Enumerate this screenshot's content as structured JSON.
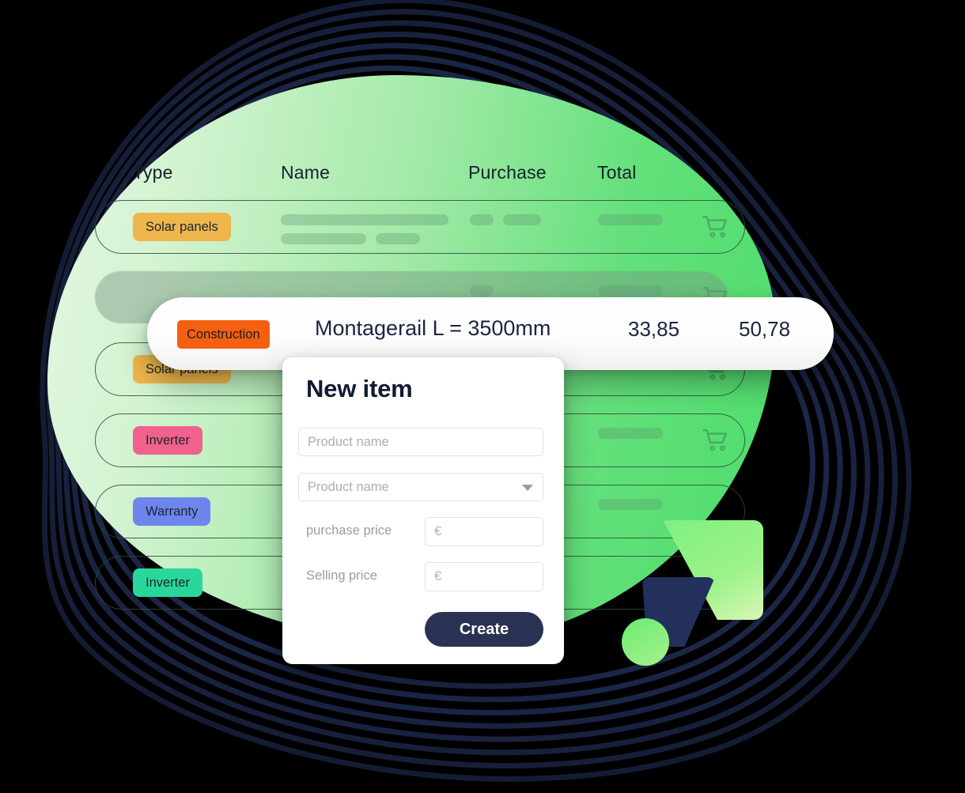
{
  "table": {
    "headers": [
      "Type",
      "Name",
      "Purchase",
      "Total"
    ],
    "rows": [
      {
        "badge": "Solar panels",
        "badge_color": "#eeb64b",
        "cart_icon": "shopping-cart-icon"
      },
      {
        "badge": "",
        "badge_color": "",
        "cart_icon": "shopping-cart-icon"
      },
      {
        "badge": "Solar panels",
        "badge_color": "#eeb64b",
        "cart_icon": "shopping-cart-icon"
      },
      {
        "badge": "Inverter",
        "badge_color": "#f0628c",
        "cart_icon": "shopping-cart-icon"
      },
      {
        "badge": "Warranty",
        "badge_color": "#6f85ee",
        "cart_icon": "shopping-cart-icon"
      },
      {
        "badge": "Inverter",
        "badge_color": "#2ad79b",
        "cart_icon": "shopping-cart-icon"
      }
    ]
  },
  "highlighted_row": {
    "badge": "Construction",
    "badge_color": "#f4600f",
    "name": "Montagerail L = 3500mm",
    "purchase": "33,85",
    "total": "50,78"
  },
  "new_item_dialog": {
    "title": "New item",
    "product_name_placeholder": "Product name",
    "product_select_placeholder": "Product name",
    "purchase_price_label": "purchase price",
    "purchase_price_placeholder": "€",
    "selling_price_label": "Selling price",
    "selling_price_placeholder": "€",
    "create_button": "Create",
    "dropdown_icon": "chevron-down-icon"
  },
  "theme": {
    "navy": "#1c2748",
    "green_light": "#e4f7e2",
    "green_bright": "#4ddd6c",
    "button_navy": "#2a3254",
    "accent_orange": "#f4600f"
  }
}
